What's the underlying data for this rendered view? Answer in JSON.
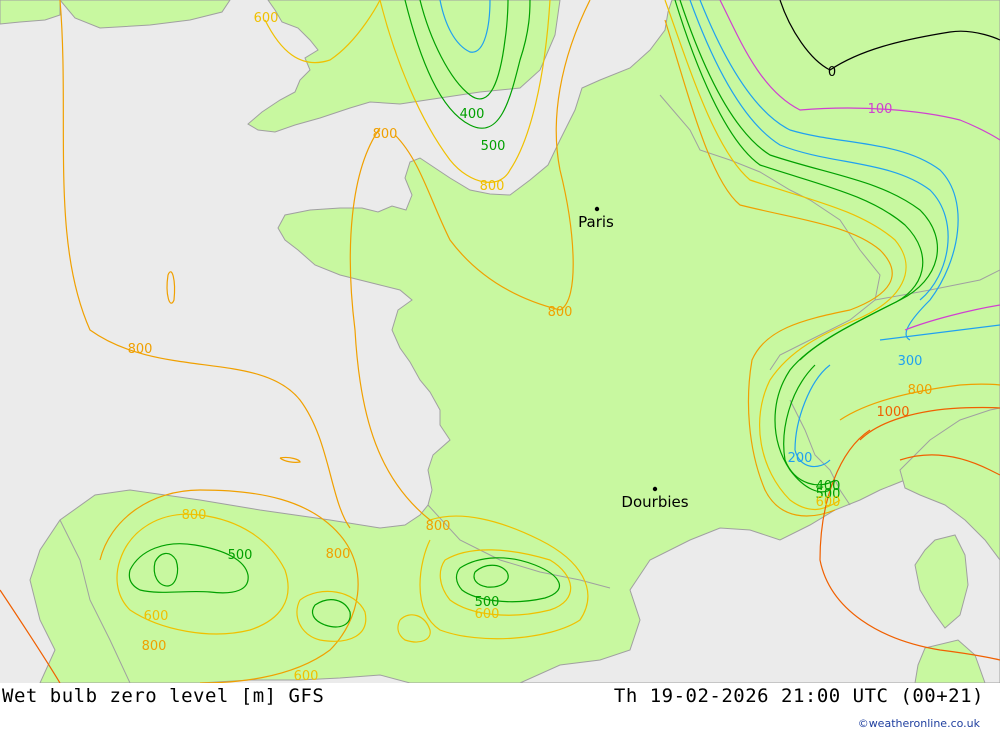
{
  "product": {
    "title": "Wet bulb zero level [m] GFS",
    "valid_time": "Th 19-02-2026 21:00 UTC (00+21)",
    "credit": "©weatheronline.co.uk"
  },
  "cities": [
    {
      "name": "Paris"
    },
    {
      "name": "Dourbies"
    }
  ],
  "contour_labels": [
    {
      "text": "600",
      "color": "#f0c000"
    },
    {
      "text": "800",
      "color": "#f0a000"
    },
    {
      "text": "400",
      "color": "#00a000"
    },
    {
      "text": "500",
      "color": "#00a000"
    },
    {
      "text": "800",
      "color": "#f0c000"
    },
    {
      "text": "800",
      "color": "#f0a000"
    },
    {
      "text": "800",
      "color": "#f0a000"
    },
    {
      "text": "0",
      "color": "#000000"
    },
    {
      "text": "100",
      "color": "#d040d0"
    },
    {
      "text": "300",
      "color": "#20a0f0"
    },
    {
      "text": "800",
      "color": "#f0a000"
    },
    {
      "text": "1000",
      "color": "#f06000"
    },
    {
      "text": "200",
      "color": "#20a0f0"
    },
    {
      "text": "400",
      "color": "#00a000"
    },
    {
      "text": "500",
      "color": "#00a000"
    },
    {
      "text": "600",
      "color": "#f0c000"
    },
    {
      "text": "800",
      "color": "#f0c000"
    },
    {
      "text": "500",
      "color": "#00a000"
    },
    {
      "text": "800",
      "color": "#f0a000"
    },
    {
      "text": "800",
      "color": "#f0a000"
    },
    {
      "text": "500",
      "color": "#00a000"
    },
    {
      "text": "600",
      "color": "#f0c000"
    },
    {
      "text": "600",
      "color": "#f0c000"
    },
    {
      "text": "800",
      "color": "#f0a000"
    },
    {
      "text": "600",
      "color": "#f0c000"
    }
  ],
  "colors": {
    "sea": "#ebebeb",
    "land": "#c8f8a0",
    "border": "#a0a0a0"
  }
}
